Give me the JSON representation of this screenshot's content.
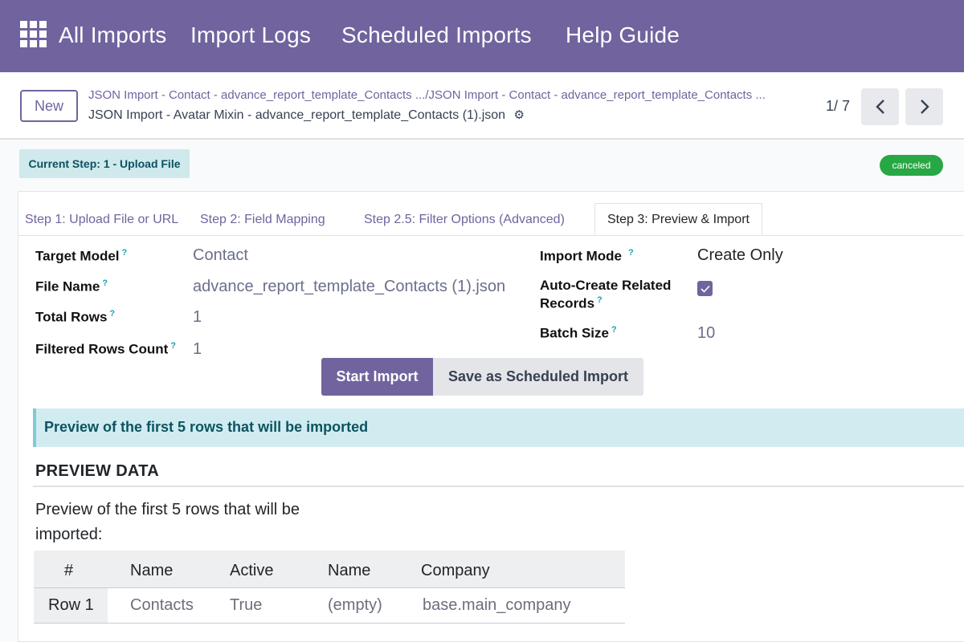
{
  "nav": {
    "apps_icon": "apps-grid-icon",
    "items": [
      "All Imports",
      "Import Logs",
      "Scheduled Imports",
      "Help Guide"
    ]
  },
  "control": {
    "new_label": "New",
    "breadcrumb_parent": "JSON Import - Contact - advance_report_template_Contacts .../JSON Import - Contact - advance_report_template_Contacts ...",
    "breadcrumb_current": "JSON Import - Avatar Mixin - advance_report_template_Contacts (1).json",
    "gear_icon": "gear-icon",
    "pager": "1/ 7"
  },
  "status": {
    "current_step": "Current Step: 1 - Upload File",
    "state": "canceled",
    "state_color": "#28a745"
  },
  "tabs": [
    "Step 1: Upload File or URL",
    "Step 2: Field Mapping",
    "Step 2.5: Filter Options (Advanced)",
    "Step 3: Preview & Import"
  ],
  "fields": {
    "target_model": {
      "label": "Target Model",
      "value": "Contact"
    },
    "file_name": {
      "label": "File Name",
      "value": "advance_report_template_Contacts (1).json"
    },
    "total_rows": {
      "label": "Total Rows",
      "value": "1"
    },
    "filtered_rows": {
      "label": "Filtered Rows Count",
      "value": "1"
    },
    "import_mode": {
      "label": "Import Mode",
      "value": "Create Only"
    },
    "auto_create": {
      "label_line1": "Auto-Create Related",
      "label_line2": "Records",
      "checked": true
    },
    "batch_size": {
      "label": "Batch Size",
      "value": "10"
    },
    "help_mark": "?"
  },
  "buttons": {
    "start": "Start Import",
    "schedule": "Save as Scheduled Import"
  },
  "alert": "Preview of the first 5 rows that will be imported",
  "preview": {
    "section_title": "PREVIEW DATA",
    "note": "Preview of the first 5 rows that will be imported:",
    "columns": [
      "#",
      "Name",
      "Active",
      "Name",
      "Company"
    ],
    "rows": [
      [
        "Row 1",
        "Contacts",
        "True",
        "(empty)",
        "base.main_company"
      ]
    ]
  },
  "colors": {
    "brand": "#71639e",
    "info": "#17a2b8"
  }
}
